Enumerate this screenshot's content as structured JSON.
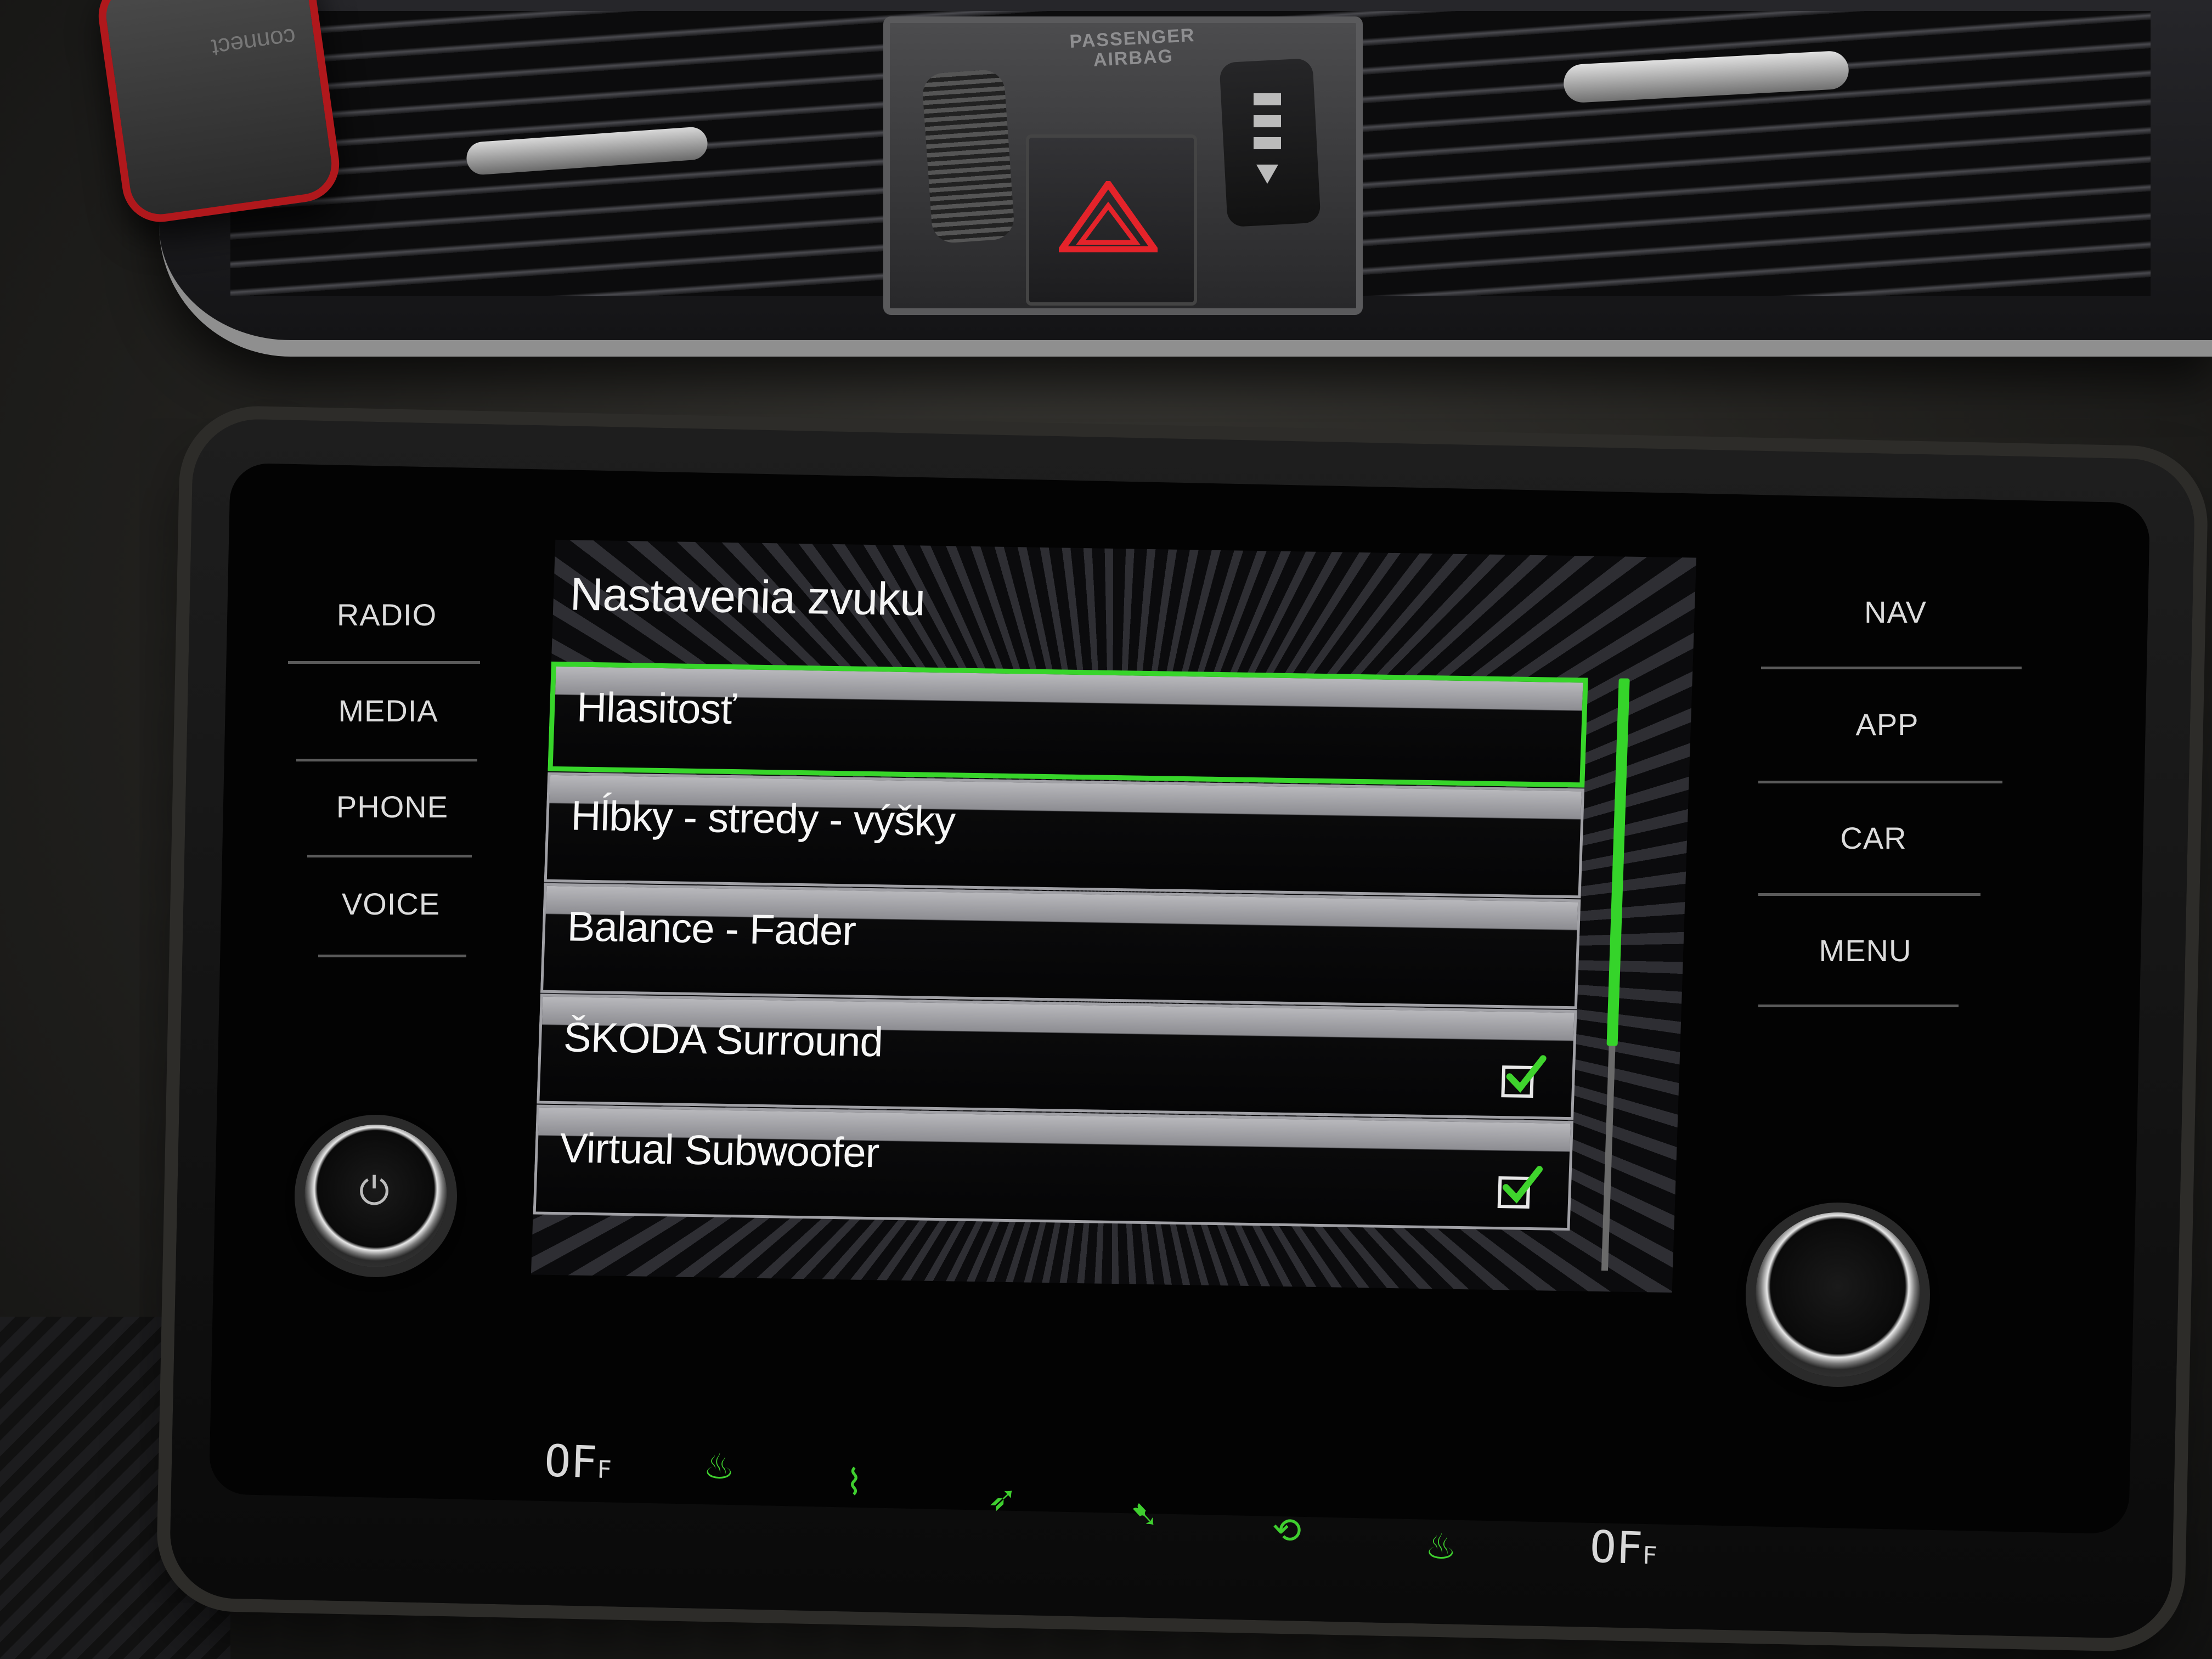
{
  "dashboard": {
    "airbag_label": "PASSENGER AIRBAG",
    "phone_holder_brand": "connect"
  },
  "side_buttons": {
    "left": [
      {
        "label": "RADIO"
      },
      {
        "label": "MEDIA"
      },
      {
        "label": "PHONE"
      },
      {
        "label": "VOICE"
      }
    ],
    "right": [
      {
        "label": "NAV"
      },
      {
        "label": "APP"
      },
      {
        "label": "CAR"
      },
      {
        "label": "MENU"
      }
    ]
  },
  "display": {
    "title": "Nastavenia zvuku",
    "items": [
      {
        "label": "Hlasitosť",
        "selected": true,
        "checked": null
      },
      {
        "label": "Hĺbky - stredy - výšky",
        "selected": false,
        "checked": null
      },
      {
        "label": "Balance - Fader",
        "selected": false,
        "checked": null
      },
      {
        "label": "ŠKODA Surround",
        "selected": false,
        "checked": true
      },
      {
        "label": "Virtual Subwoofer",
        "selected": false,
        "checked": true
      }
    ],
    "scroll_fraction": 0.62,
    "accent_color": "#35d42a"
  },
  "climate": {
    "left_temp": "OF",
    "left_temp_suffix": "F",
    "right_temp": "OF",
    "right_temp_suffix": "F",
    "icons": [
      "seat-heat-icon",
      "windshield-defrost-icon",
      "air-direction-icon",
      "air-floor-icon",
      "recirculation-icon",
      "seat-heat-icon"
    ],
    "icon_color": "#3fcf2f"
  }
}
